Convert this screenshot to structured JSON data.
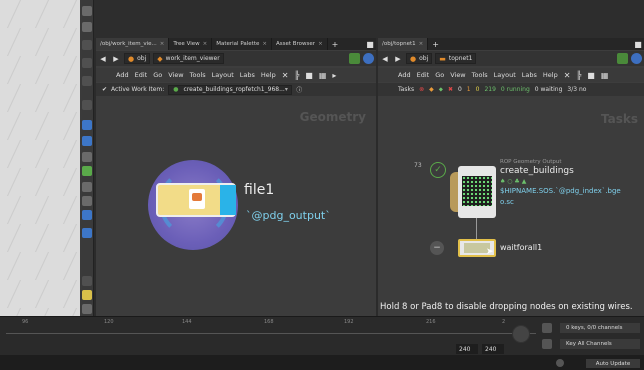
{
  "left_pane": {
    "tabs": [
      {
        "label": "/obj/work_item_vie...",
        "close": "×"
      },
      {
        "label": "Tree View",
        "close": "×"
      },
      {
        "label": "Material Palette",
        "close": "×"
      },
      {
        "label": "Asset Browser",
        "close": "×"
      }
    ],
    "add_tab": "+",
    "path_root": "obj",
    "path_node": "work_item_viewer",
    "menu": [
      "Add",
      "Edit",
      "Go",
      "View",
      "Tools",
      "Layout",
      "Labs",
      "Help"
    ],
    "active_work_item_label": "Active Work Item:",
    "active_work_item_value": "create_buildings_ropfetch1_968...",
    "watermark": "Geometry",
    "file_node": {
      "name": "file1",
      "expression": "`@pdg_output`"
    }
  },
  "right_pane": {
    "tabs": [
      {
        "label": "/obj/topnet1",
        "close": "×"
      }
    ],
    "add_tab": "+",
    "path_root": "obj",
    "path_node": "topnet1",
    "menu": [
      "Add",
      "Edit",
      "Go",
      "View",
      "Tools",
      "Layout",
      "Labs",
      "Help"
    ],
    "task_bar": {
      "label": "Tasks",
      "cancelled": "0",
      "failed": "1",
      "queued": "0",
      "cooked": "219",
      "running": "0 running",
      "waiting": "0 waiting",
      "progress": "3/3 no"
    },
    "watermark": "Tasks",
    "rop_node": {
      "badge": "73",
      "type_label": "ROP Geometry Output",
      "name": "create_buildings",
      "icons": "♠ ○ ♣ ▲",
      "expr_line1": "$HIPNAME.SOS.`@pdg_index`.bge",
      "expr_line2": "o.sc"
    },
    "wait_node": {
      "name": "waitforall1"
    },
    "hint": "Hold 8 or Pad8 to disable dropping nodes on existing wires."
  },
  "timeline": {
    "ticks": [
      "96",
      "120",
      "144",
      "168",
      "192",
      "216",
      "2"
    ],
    "frame_end": "240",
    "frame_end2": "240",
    "keys_info": "0 keys, 0/0 channels",
    "key_channels": "Key All Channels",
    "auto_update": "Auto Update"
  }
}
